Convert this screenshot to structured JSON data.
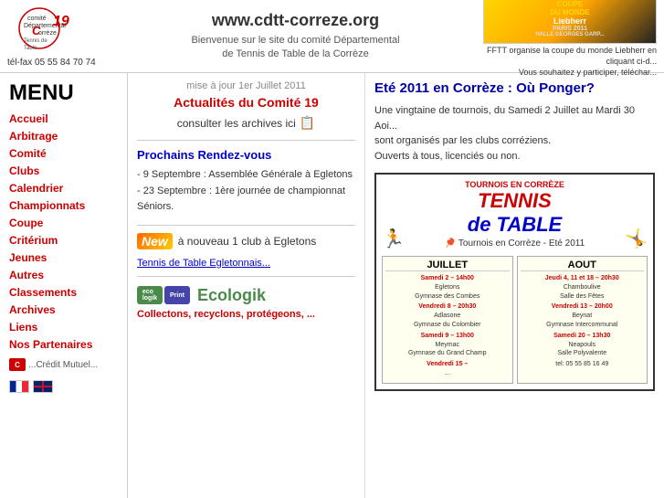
{
  "header": {
    "site_url": "www.cdtt-correze.org",
    "description_line1": "Bienvenue sur le site du comité Départemental",
    "description_line2": "de Tennis de Table de la Corrèze",
    "tel": "tél-fax 05 55 84 70 74",
    "banner_text": "FFTT organise la coupe du monde Liebherr en cliquant ci-d...",
    "banner_subtitle": "Vous souhaitez y participer, téléchar..."
  },
  "sidebar": {
    "menu_title": "MENU",
    "nav_items": [
      {
        "label": "Accueil",
        "href": "#"
      },
      {
        "label": "Arbitrage",
        "href": "#"
      },
      {
        "label": "Comité",
        "href": "#"
      },
      {
        "label": "Clubs",
        "href": "#"
      },
      {
        "label": "Calendrier",
        "href": "#"
      },
      {
        "label": "Championnats",
        "href": "#"
      },
      {
        "label": "Coupe",
        "href": "#"
      },
      {
        "label": "Critérium",
        "href": "#"
      },
      {
        "label": "Jeunes",
        "href": "#"
      },
      {
        "label": "Autres",
        "href": "#"
      },
      {
        "label": "Classements",
        "href": "#"
      },
      {
        "label": "Archives",
        "href": "#"
      },
      {
        "label": "Liens",
        "href": "#"
      },
      {
        "label": "Nos Partenaires",
        "href": "#"
      }
    ],
    "credit": "...Crédit Mutuel..."
  },
  "main_content": {
    "update_date": "mise à jour 1er Juillet 2011",
    "news_title": "Actualités du Comité 19",
    "archives_text": "consulter les archives ici",
    "rdv_title": "Prochains Rendez-vous",
    "rdv_items": [
      "- 9 Septembre : Assemblée Générale à Egletons",
      "- 23 Septembre : 1ère journée de championnat Séniors."
    ],
    "new_text": "à nouveau 1 club à Egletons",
    "club_link": "Tennis de Table Egletonnais...",
    "ecologik_title": "Ecologik",
    "ecologik_desc": "Collectons, recyclons, protégeons, ..."
  },
  "right_content": {
    "ponger_title": "Eté 2011 en Corrèze : Où Ponger?",
    "ponger_desc1": "Une vingtaine de tournois, du Samedi 2 Juillet au Mardi 30 Aoi...",
    "ponger_desc2": "sont organisés par les clubs corréziens.",
    "ponger_desc3": "Ouverts à tous, licenciés ou non.",
    "poster": {
      "title_tt": "TOURNOIS EN CORRÈZE",
      "title_line1": "TENNIS",
      "title_line2": "de TABLE",
      "subtitle": "🏓 Tournois en Corrèze - Eté 2011",
      "months": [
        {
          "name": "JUILLET",
          "events": [
            {
              "date": "Samedi 2 – 14h00",
              "place": "Egletons",
              "detail": "Gymnase des Combes"
            },
            {
              "date": "Vendredi 8 – 20h30",
              "place": "Adlasone",
              "detail": "Gymnase du Colombier"
            },
            {
              "date": "Samedi 9 – 13h00",
              "place": "Meymac",
              "detail": "Gymnase du Grand Champ"
            },
            {
              "date": "Vendredi 15 –",
              "place": "...",
              "detail": ""
            }
          ]
        },
        {
          "name": "AOUT",
          "events": [
            {
              "date": "Jeudi 4, 11 et 18 – 20h30",
              "place": "Chamboulive",
              "detail": "Salle des Fêtes"
            },
            {
              "date": "Vendredi 13 – 20h00",
              "place": "Beynat",
              "detail": "Gymnase Intercommunal"
            },
            {
              "date": "Samedi 20 – 13h30",
              "place": "Neapouls",
              "detail": "Salle Polyvalente"
            },
            {
              "date": "tel: 05 55 85 16 49",
              "place": "",
              "detail": ""
            }
          ]
        }
      ]
    }
  },
  "icons": {
    "archive": "📋",
    "new_badge": "New",
    "scroll_up": "▲",
    "scroll_down": "▼"
  }
}
